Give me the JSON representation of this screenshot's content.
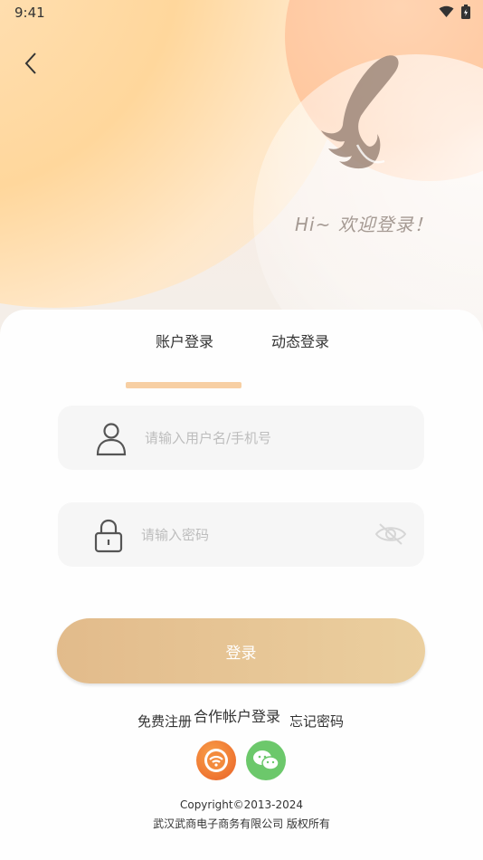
{
  "status_bar": {
    "time": "9:41",
    "icons": [
      "wifi-icon",
      "battery-icon"
    ]
  },
  "header": {
    "back_icon": "chevron-left-icon",
    "greeting": "Hi~ 欢迎登录！"
  },
  "tabs": {
    "active": "账户登录",
    "other": "动态登录"
  },
  "fields": {
    "username_placeholder": "请输入用户名/手机号",
    "password_placeholder": "请输入密码",
    "user_icon": "user-icon",
    "lock_icon": "lock-icon",
    "eye_icon": "eye-off-icon"
  },
  "login_button": {
    "label": "登录"
  },
  "links": {
    "register": "免费注册",
    "partner": "合作帐户登录",
    "forgot": "忘记密码"
  },
  "social_icons": [
    "partner-app-icon",
    "wechat-icon"
  ],
  "footer": {
    "copyright": "Copyright©2013-2024",
    "company": "武汉武商电子商务有限公司 版权所有"
  },
  "colors": {
    "accent": "#f7cfa3",
    "button_start": "#e2bb8b",
    "button_end": "#ebcf9f",
    "wechat": "#6cc86b",
    "partner": "#f0803c"
  }
}
